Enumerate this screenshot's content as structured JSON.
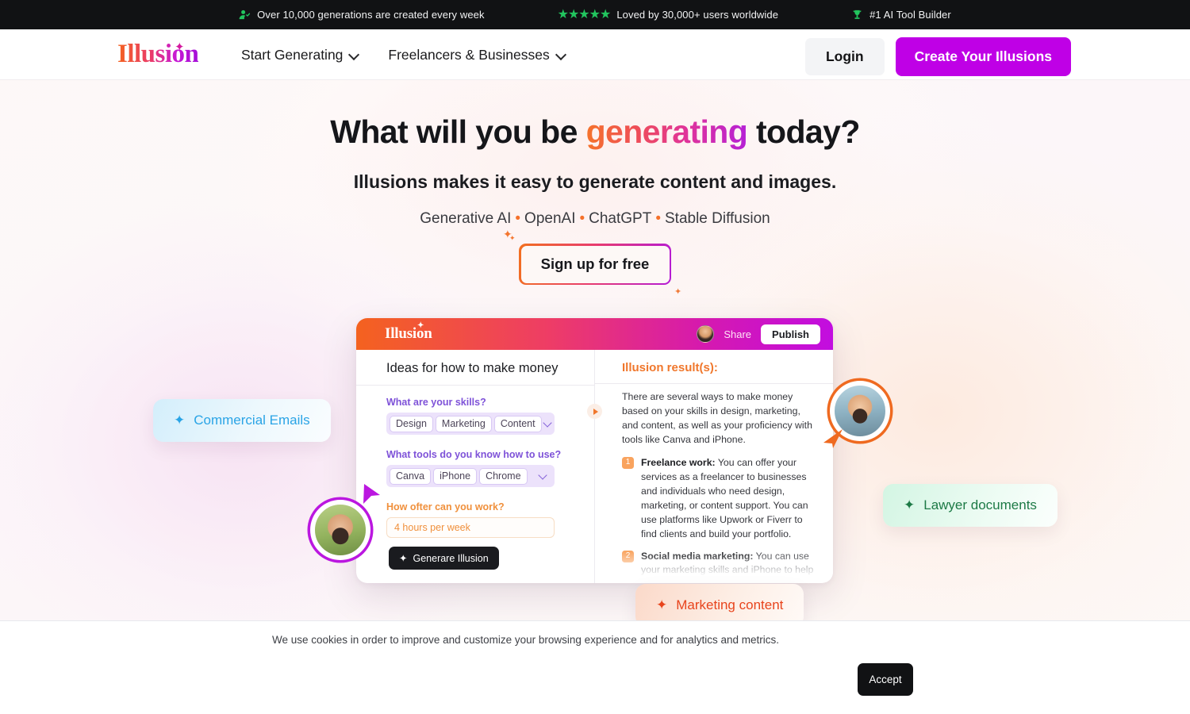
{
  "announcement": {
    "items": [
      {
        "icon": "user-check-icon",
        "text": "Over 10,000 generations are created every week"
      },
      {
        "icon": "five-stars-icon",
        "stars": "★★★★★",
        "text": "Loved by 30,000+ users worldwide"
      },
      {
        "icon": "trophy-icon",
        "text": "#1 AI Tool Builder"
      }
    ]
  },
  "header": {
    "logo": "Illusion",
    "nav": [
      {
        "label": "Start Generating",
        "icon": "chevron-down-icon"
      },
      {
        "label": "Freelancers & Businesses",
        "icon": "chevron-down-icon"
      }
    ],
    "login_label": "Login",
    "create_label": "Create Your Illusions"
  },
  "hero": {
    "title_part1": "What will you be ",
    "title_highlight": "generating",
    "title_part2": " today?",
    "subtitle": "Illusions makes it easy to generate content and images.",
    "tags": [
      "Generative AI",
      "OpenAI",
      "ChatGPT",
      "Stable Diffusion"
    ],
    "cta_label": "Sign up for free"
  },
  "mockup": {
    "logo": "Illusion",
    "share_label": "Share",
    "publish_label": "Publish",
    "doc_title": "Ideas for how to make money",
    "result_title": "Illusion result(s):",
    "fields": [
      {
        "label": "What are your skills?",
        "type": "chips",
        "chips": [
          "Design",
          "Marketing",
          "Content"
        ]
      },
      {
        "label": "What tools do you know how to use?",
        "type": "chips",
        "chips": [
          "Canva",
          "iPhone",
          "Chrome"
        ]
      },
      {
        "label": "How ofter can you work?",
        "type": "text",
        "value": "4 hours per week"
      }
    ],
    "generate_label": "Generare Illusion",
    "result_intro": "There are several ways to make money based on your skills in design, marketing, and content, as well as your proficiency with tools like Canva and iPhone.",
    "result_items": [
      {
        "num": "1",
        "heading": "Freelance work:",
        "body": " You can offer your services as a freelancer to businesses and individuals who need design, marketing, or content support. You can use platforms like Upwork or Fiverr to find clients and build your portfolio."
      },
      {
        "num": "2",
        "heading": "Social media marketing:",
        "body": " You can use your marketing skills and iPhone to help businesses and individuals grow their social media presence by creating and"
      }
    ]
  },
  "pills": [
    {
      "label": "Commercial Emails",
      "icon": "sparkle-icon",
      "color": "#2aa4e6"
    },
    {
      "label": "Lawyer documents",
      "icon": "sparkle-icon",
      "color": "#1d7a46"
    },
    {
      "label": "Marketing content",
      "icon": "sparkle-icon",
      "color": "#e8441c"
    }
  ],
  "cookie": {
    "text": "We use cookies in order to improve and customize your browsing experience and for analytics and metrics.",
    "accept_label": "Accept"
  },
  "colors": {
    "brand_orange": "#f4621f",
    "brand_magenta": "#c20de0",
    "cta_purple": "#bf00e6",
    "accent_green": "#22c55e",
    "dark": "#111214"
  }
}
